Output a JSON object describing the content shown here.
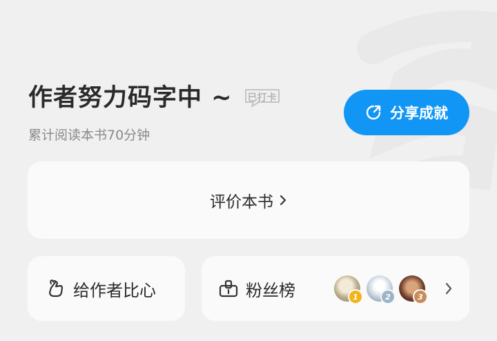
{
  "header": {
    "title": "作者努力码字中 ~",
    "stamp": "已打卡",
    "subtitle": "累计阅读本书70分钟"
  },
  "share_button": {
    "label": "分享成就",
    "icon": "share-icon",
    "color": "#1296f5"
  },
  "rate_card": {
    "label": "评价本书",
    "icon": "chevron-right-icon"
  },
  "gift_card": {
    "label": "给作者比心",
    "icon": "finger-heart-icon"
  },
  "fans_card": {
    "label": "粉丝榜",
    "icon": "fans-rank-icon",
    "avatars": [
      {
        "rank": "1",
        "badge_color": "#f2b419"
      },
      {
        "rank": "2",
        "badge_color": "#9db3c9"
      },
      {
        "rank": "3",
        "badge_color": "#c98b5a"
      }
    ]
  }
}
